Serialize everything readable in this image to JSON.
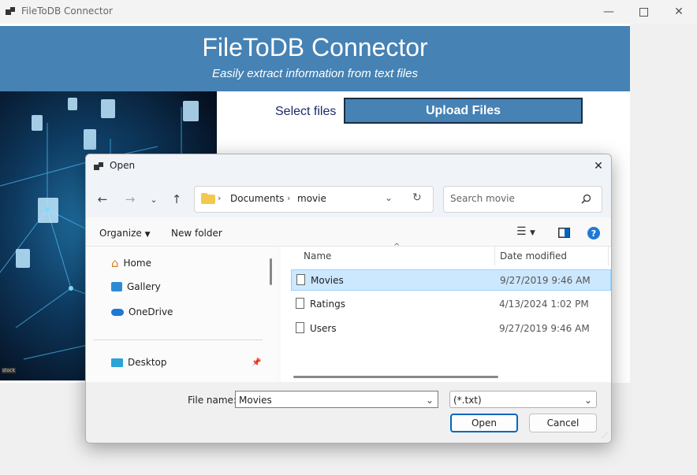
{
  "window": {
    "title": "FileToDB Connector"
  },
  "header": {
    "title": "FileToDB Connector",
    "subtitle": "Easily extract information from text files"
  },
  "hero": {
    "watermark": "stock"
  },
  "main": {
    "select_label": "Select files",
    "upload_label": "Upload Files"
  },
  "dialog": {
    "title": "Open",
    "breadcrumb": [
      "Documents",
      "movie"
    ],
    "search_placeholder": "Search movie",
    "toolbar": {
      "organize": "Organize",
      "new_folder": "New folder"
    },
    "nav": [
      {
        "label": "Home",
        "icon": "home-icon"
      },
      {
        "label": "Gallery",
        "icon": "gallery-icon"
      },
      {
        "label": "OneDrive",
        "icon": "cloud-icon"
      },
      {
        "label": "Desktop",
        "icon": "desktop-icon"
      }
    ],
    "columns": {
      "name": "Name",
      "date": "Date modified"
    },
    "files": [
      {
        "name": "Movies",
        "date": "9/27/2019 9:46 AM",
        "selected": true
      },
      {
        "name": "Ratings",
        "date": "4/13/2024 1:02 PM",
        "selected": false
      },
      {
        "name": "Users",
        "date": "9/27/2019 9:46 AM",
        "selected": false
      }
    ],
    "file_name_label": "File name:",
    "file_name_value": "Movies",
    "filter": "(*.txt)",
    "open_label": "Open",
    "cancel_label": "Cancel"
  },
  "colors": {
    "header_blue": "#4682b4",
    "selection": "#cce8ff",
    "accent": "#0067c0"
  }
}
